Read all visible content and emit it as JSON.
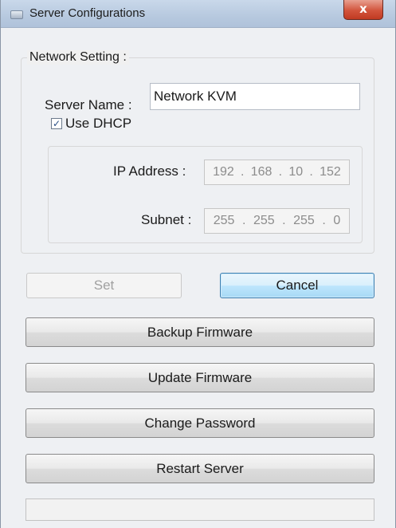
{
  "window": {
    "title": "Server Configurations",
    "close_glyph": "x"
  },
  "network_setting": {
    "legend": "Network Setting :",
    "server_name_label": "Server Name :",
    "server_name_value": "Network KVM",
    "dhcp_label": "Use DHCP",
    "dhcp_checked": true,
    "ip_label": "IP Address :",
    "ip_octets": [
      "192",
      "168",
      "10",
      "152"
    ],
    "subnet_label": "Subnet :",
    "subnet_octets": [
      "255",
      "255",
      "255",
      "0"
    ]
  },
  "buttons": {
    "set": "Set",
    "cancel": "Cancel",
    "backup_firmware": "Backup Firmware",
    "update_firmware": "Update Firmware",
    "change_password": "Change Password",
    "restart_server": "Restart Server"
  },
  "colors": {
    "close_button": "#d2543c",
    "default_button_border": "#3c7fb1"
  },
  "icons": {
    "app": "app-window-icon",
    "check": "checkmark-icon"
  }
}
